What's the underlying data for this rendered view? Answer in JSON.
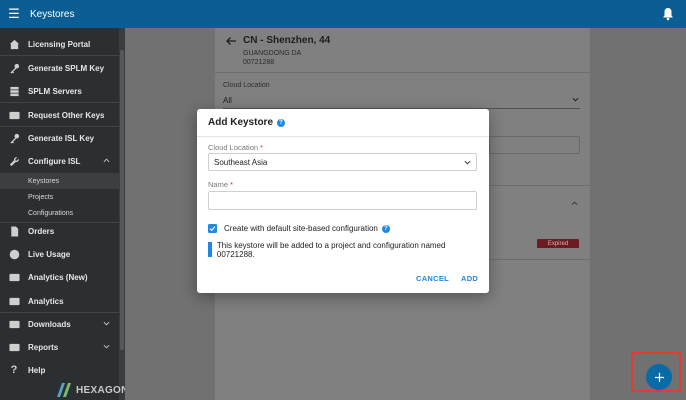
{
  "topbar": {
    "title": "Keystores"
  },
  "sidebar": {
    "items": [
      {
        "label": "Licensing Portal",
        "icon": "home-icon"
      },
      {
        "label": "Generate SPLM Key",
        "icon": "key-icon"
      },
      {
        "label": "SPLM Servers",
        "icon": "server-icon"
      },
      {
        "label": "Request Other Keys",
        "icon": "card-icon"
      },
      {
        "label": "Generate ISL Key",
        "icon": "key-icon"
      },
      {
        "label": "Configure ISL",
        "icon": "wrench-icon"
      },
      {
        "label": "Orders",
        "icon": "document-icon"
      },
      {
        "label": "Live Usage",
        "icon": "globe-icon"
      },
      {
        "label": "Analytics (New)",
        "icon": "chart-card-icon"
      },
      {
        "label": "Analytics",
        "icon": "chart-card-icon"
      },
      {
        "label": "Downloads",
        "icon": "download-icon"
      },
      {
        "label": "Reports",
        "icon": "report-icon"
      },
      {
        "label": "Help",
        "icon": "help-icon"
      }
    ],
    "subitems": [
      "Keystores",
      "Projects",
      "Configurations"
    ],
    "logo_text": "HEXAGON"
  },
  "panel": {
    "title": "CN - Shenzhen, 44",
    "subtitle1": "GUANGDONG DA",
    "subtitle2": "00721288",
    "cloud_location_label": "Cloud Location",
    "cloud_location_value": "All",
    "status_badge": "Expired"
  },
  "dialog": {
    "title": "Add Keystore",
    "cloud_location_label": "Cloud Location",
    "cloud_location_value": "Southeast Asia",
    "name_label": "Name",
    "required_mark": "*",
    "checkbox_label": "Create with default site-based configuration",
    "checkbox_checked": true,
    "info_text": "This keystore will be added to a project and configuration named 00721288.",
    "cancel_label": "CANCEL",
    "add_label": "ADD"
  },
  "colors": {
    "topbar": "#0a5e93",
    "accent": "#1e88e5",
    "sidebar": "#2c2f31",
    "highlight": "#e53935"
  }
}
